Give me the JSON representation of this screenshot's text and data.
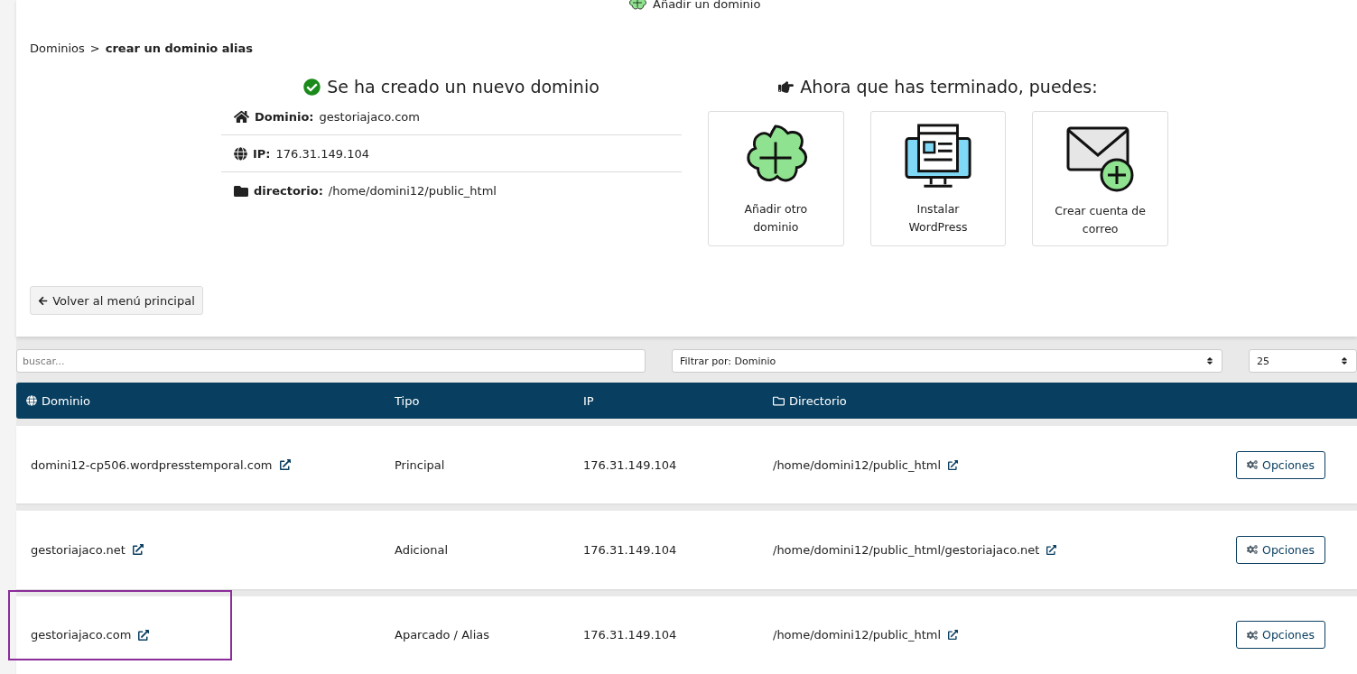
{
  "top_action": {
    "label": "Añadir un dominio"
  },
  "breadcrumb": {
    "parent": "Dominios",
    "separator": ">",
    "current": "crear un dominio alias"
  },
  "result": {
    "title": "Se ha creado un nuevo dominio",
    "details": [
      {
        "kind": "home",
        "label": "Dominio:",
        "value": "gestoriajaco.com"
      },
      {
        "kind": "globe",
        "label": "IP:",
        "value": "176.31.149.104"
      },
      {
        "kind": "folder",
        "label": "directorio:",
        "value": "/home/domini12/public_html"
      }
    ]
  },
  "next_steps": {
    "title": "Ahora que has terminado, puedes:",
    "cards": [
      {
        "kind": "add-domain",
        "label": "Añadir otro dominio"
      },
      {
        "kind": "wordpress",
        "label": "Instalar WordPress"
      },
      {
        "kind": "email",
        "label": "Crear cuenta de correo"
      }
    ]
  },
  "back_button": {
    "label": "Volver al menú principal"
  },
  "filters": {
    "search_placeholder": "buscar...",
    "filter_value": "Filtrar por: Dominio",
    "per_page": "25"
  },
  "table": {
    "columns": [
      {
        "label": "Dominio",
        "kind": "globe"
      },
      {
        "label": "Tipo",
        "kind": "plain"
      },
      {
        "label": "IP",
        "kind": "plain"
      },
      {
        "label": "Directorio",
        "kind": "folder"
      }
    ],
    "rows": [
      {
        "domain": "domini12-cp506.wordpresstemporal.com",
        "type": "Principal",
        "ip": "176.31.149.104",
        "directory": "/home/domini12/public_html",
        "action": "Opciones",
        "highlighted": false
      },
      {
        "domain": "gestoriajaco.net",
        "type": "Adicional",
        "ip": "176.31.149.104",
        "directory": "/home/domini12/public_html/gestoriajaco.net",
        "action": "Opciones",
        "highlighted": false
      },
      {
        "domain": "gestoriajaco.com",
        "type": "Aparcado / Alias",
        "ip": "176.31.149.104",
        "directory": "/home/domini12/public_html",
        "action": "Opciones",
        "highlighted": true
      }
    ]
  }
}
